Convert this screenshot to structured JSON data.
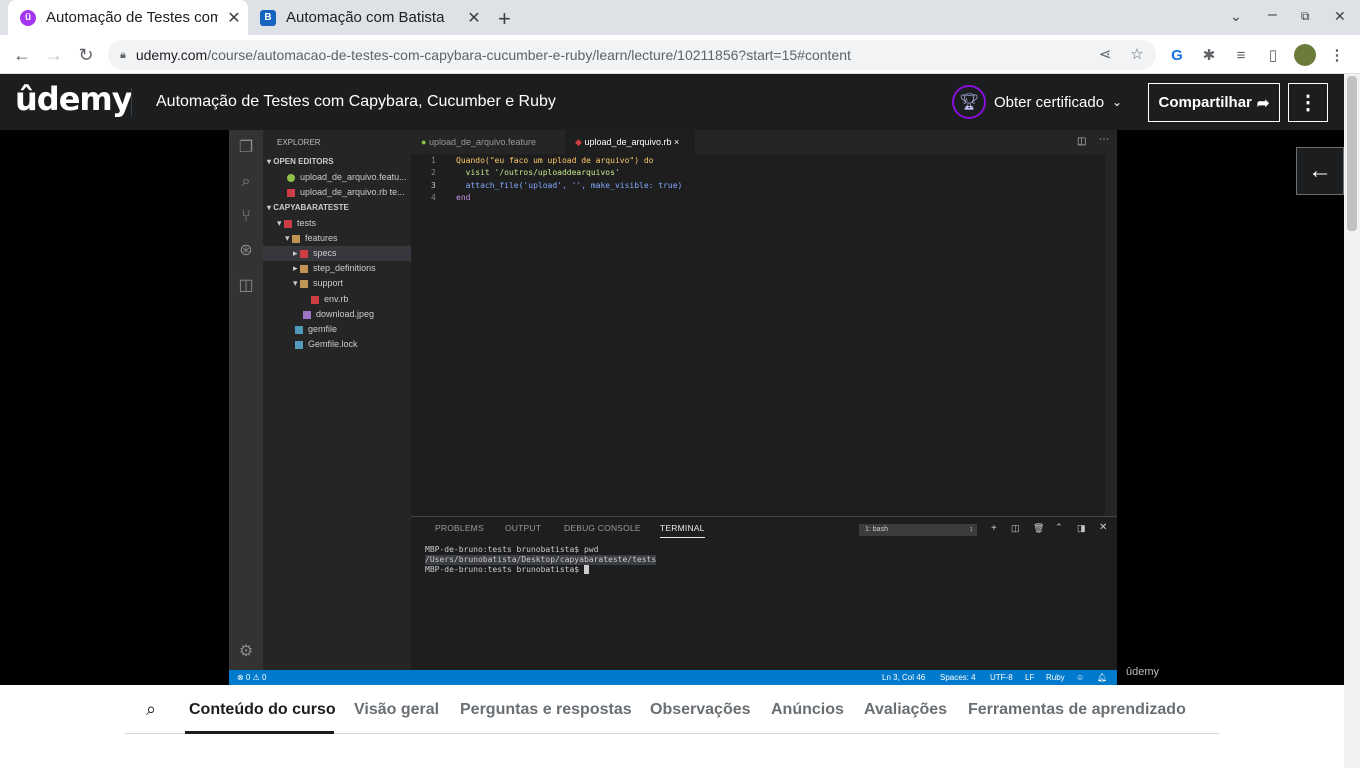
{
  "browser": {
    "tabs": [
      {
        "title": "Automação de Testes com Capybara",
        "icon": "udemy-favicon",
        "active": true
      },
      {
        "title": "Automação com Batista",
        "icon": "b-favicon",
        "active": false
      }
    ],
    "new_tab_symbol": "+",
    "url_host": "udemy.com",
    "url_path": "/course/automacao-de-testes-com-capybara-cucumber-e-ruby/learn/lecture/10211856?start=15#content"
  },
  "header": {
    "logo": "ûdemy",
    "course_title": "Automação de Testes com Capybara, Cucumber e Ruby",
    "certificate_label": "Obter certificado",
    "share_label": "Compartilhar"
  },
  "vscode": {
    "explorer_title": "EXPLORER",
    "open_editors_title": "OPEN EDITORS",
    "open_editors": [
      {
        "name": "upload_de_arquivo.featu...",
        "color": "#8dc149"
      },
      {
        "name": "upload_de_arquivo.rb te...",
        "color": "#cc3e44"
      }
    ],
    "project_title": "CAPYABARATESTE",
    "tree": [
      {
        "name": "tests",
        "level": 0,
        "arrow": "▾",
        "color": "#cc3e44"
      },
      {
        "name": "features",
        "level": 1,
        "arrow": "▾",
        "color": "#c09553"
      },
      {
        "name": "specs",
        "level": 2,
        "arrow": "▸",
        "color": "#cc3e44"
      },
      {
        "name": "step_definitions",
        "level": 2,
        "arrow": "▸",
        "color": "#c09553"
      },
      {
        "name": "support",
        "level": 2,
        "arrow": "▾",
        "color": "#c09553"
      },
      {
        "name": "env.rb",
        "level": 3,
        "arrow": "",
        "color": "#cc3e44"
      },
      {
        "name": "download.jpeg",
        "level": 2,
        "arrow": "",
        "color": "#a074c4"
      },
      {
        "name": "gemfile",
        "level": 1,
        "arrow": "",
        "color": "#519aba"
      },
      {
        "name": "Gemfile.lock",
        "level": 1,
        "arrow": "",
        "color": "#519aba"
      }
    ],
    "editor_tabs": [
      {
        "name": "upload_de_arquivo.feature",
        "active": false
      },
      {
        "name": "upload_de_arquivo.rb",
        "active": true,
        "close": "×"
      }
    ],
    "code_lines": [
      {
        "num": "1",
        "text": "Quando(\"eu faco um upload de arquivo\") do"
      },
      {
        "num": "2",
        "text": "  visit '/outros/uploaddearquivos'"
      },
      {
        "num": "3",
        "text": "  attach_file('upload', '', make_visible: true)"
      },
      {
        "num": "4",
        "text": "end"
      }
    ],
    "panel_tabs": [
      "PROBLEMS",
      "OUTPUT",
      "DEBUG CONSOLE",
      "TERMINAL"
    ],
    "terminal_select": "1: bash",
    "terminal_lines": [
      "MBP-de-bruno:tests brunobatista$ pwd",
      "/Users/brunobatista/Desktop/capyabarateste/tests",
      "MBP-de-bruno:tests brunobatista$ "
    ],
    "status_left": "⊗ 0 ⚠ 0",
    "status_right": [
      "Ln 3, Col 46",
      "Spaces: 4",
      "UTF-8",
      "LF",
      "Ruby"
    ],
    "watermark": "ûdemy"
  },
  "course_tabs": [
    "Conteúdo do curso",
    "Visão geral",
    "Perguntas e respostas",
    "Observações",
    "Anúncios",
    "Avaliações",
    "Ferramentas de aprendizado"
  ],
  "colors": {
    "udemy_purple": "#8710d8",
    "vscode_blue": "#007acc",
    "header_bg": "#1c1d1f"
  }
}
